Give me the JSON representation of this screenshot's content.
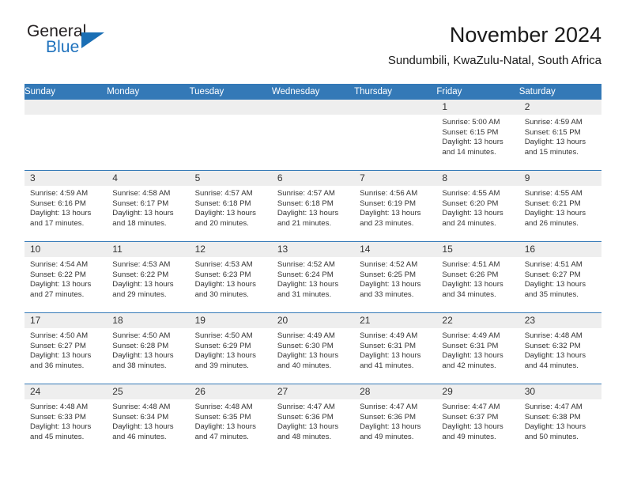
{
  "brand": {
    "name_part1": "General",
    "name_part2": "Blue",
    "triangle_color": "#1a6fb5"
  },
  "header": {
    "title": "November 2024",
    "subtitle": "Sundumbili, KwaZulu-Natal, South Africa"
  },
  "theme": {
    "header_bg": "#3479b7",
    "header_text": "#ffffff",
    "daynum_band_bg": "#eeeeee",
    "row_divider": "#3479b7",
    "body_text": "#333333"
  },
  "calendar": {
    "weekday_headers": [
      "Sunday",
      "Monday",
      "Tuesday",
      "Wednesday",
      "Thursday",
      "Friday",
      "Saturday"
    ],
    "weeks": [
      [
        {
          "day": "",
          "sunrise": "",
          "sunset": "",
          "daylight_line1": "",
          "daylight_line2": ""
        },
        {
          "day": "",
          "sunrise": "",
          "sunset": "",
          "daylight_line1": "",
          "daylight_line2": ""
        },
        {
          "day": "",
          "sunrise": "",
          "sunset": "",
          "daylight_line1": "",
          "daylight_line2": ""
        },
        {
          "day": "",
          "sunrise": "",
          "sunset": "",
          "daylight_line1": "",
          "daylight_line2": ""
        },
        {
          "day": "",
          "sunrise": "",
          "sunset": "",
          "daylight_line1": "",
          "daylight_line2": ""
        },
        {
          "day": "1",
          "sunrise": "Sunrise: 5:00 AM",
          "sunset": "Sunset: 6:15 PM",
          "daylight_line1": "Daylight: 13 hours",
          "daylight_line2": "and 14 minutes."
        },
        {
          "day": "2",
          "sunrise": "Sunrise: 4:59 AM",
          "sunset": "Sunset: 6:15 PM",
          "daylight_line1": "Daylight: 13 hours",
          "daylight_line2": "and 15 minutes."
        }
      ],
      [
        {
          "day": "3",
          "sunrise": "Sunrise: 4:59 AM",
          "sunset": "Sunset: 6:16 PM",
          "daylight_line1": "Daylight: 13 hours",
          "daylight_line2": "and 17 minutes."
        },
        {
          "day": "4",
          "sunrise": "Sunrise: 4:58 AM",
          "sunset": "Sunset: 6:17 PM",
          "daylight_line1": "Daylight: 13 hours",
          "daylight_line2": "and 18 minutes."
        },
        {
          "day": "5",
          "sunrise": "Sunrise: 4:57 AM",
          "sunset": "Sunset: 6:18 PM",
          "daylight_line1": "Daylight: 13 hours",
          "daylight_line2": "and 20 minutes."
        },
        {
          "day": "6",
          "sunrise": "Sunrise: 4:57 AM",
          "sunset": "Sunset: 6:18 PM",
          "daylight_line1": "Daylight: 13 hours",
          "daylight_line2": "and 21 minutes."
        },
        {
          "day": "7",
          "sunrise": "Sunrise: 4:56 AM",
          "sunset": "Sunset: 6:19 PM",
          "daylight_line1": "Daylight: 13 hours",
          "daylight_line2": "and 23 minutes."
        },
        {
          "day": "8",
          "sunrise": "Sunrise: 4:55 AM",
          "sunset": "Sunset: 6:20 PM",
          "daylight_line1": "Daylight: 13 hours",
          "daylight_line2": "and 24 minutes."
        },
        {
          "day": "9",
          "sunrise": "Sunrise: 4:55 AM",
          "sunset": "Sunset: 6:21 PM",
          "daylight_line1": "Daylight: 13 hours",
          "daylight_line2": "and 26 minutes."
        }
      ],
      [
        {
          "day": "10",
          "sunrise": "Sunrise: 4:54 AM",
          "sunset": "Sunset: 6:22 PM",
          "daylight_line1": "Daylight: 13 hours",
          "daylight_line2": "and 27 minutes."
        },
        {
          "day": "11",
          "sunrise": "Sunrise: 4:53 AM",
          "sunset": "Sunset: 6:22 PM",
          "daylight_line1": "Daylight: 13 hours",
          "daylight_line2": "and 29 minutes."
        },
        {
          "day": "12",
          "sunrise": "Sunrise: 4:53 AM",
          "sunset": "Sunset: 6:23 PM",
          "daylight_line1": "Daylight: 13 hours",
          "daylight_line2": "and 30 minutes."
        },
        {
          "day": "13",
          "sunrise": "Sunrise: 4:52 AM",
          "sunset": "Sunset: 6:24 PM",
          "daylight_line1": "Daylight: 13 hours",
          "daylight_line2": "and 31 minutes."
        },
        {
          "day": "14",
          "sunrise": "Sunrise: 4:52 AM",
          "sunset": "Sunset: 6:25 PM",
          "daylight_line1": "Daylight: 13 hours",
          "daylight_line2": "and 33 minutes."
        },
        {
          "day": "15",
          "sunrise": "Sunrise: 4:51 AM",
          "sunset": "Sunset: 6:26 PM",
          "daylight_line1": "Daylight: 13 hours",
          "daylight_line2": "and 34 minutes."
        },
        {
          "day": "16",
          "sunrise": "Sunrise: 4:51 AM",
          "sunset": "Sunset: 6:27 PM",
          "daylight_line1": "Daylight: 13 hours",
          "daylight_line2": "and 35 minutes."
        }
      ],
      [
        {
          "day": "17",
          "sunrise": "Sunrise: 4:50 AM",
          "sunset": "Sunset: 6:27 PM",
          "daylight_line1": "Daylight: 13 hours",
          "daylight_line2": "and 36 minutes."
        },
        {
          "day": "18",
          "sunrise": "Sunrise: 4:50 AM",
          "sunset": "Sunset: 6:28 PM",
          "daylight_line1": "Daylight: 13 hours",
          "daylight_line2": "and 38 minutes."
        },
        {
          "day": "19",
          "sunrise": "Sunrise: 4:50 AM",
          "sunset": "Sunset: 6:29 PM",
          "daylight_line1": "Daylight: 13 hours",
          "daylight_line2": "and 39 minutes."
        },
        {
          "day": "20",
          "sunrise": "Sunrise: 4:49 AM",
          "sunset": "Sunset: 6:30 PM",
          "daylight_line1": "Daylight: 13 hours",
          "daylight_line2": "and 40 minutes."
        },
        {
          "day": "21",
          "sunrise": "Sunrise: 4:49 AM",
          "sunset": "Sunset: 6:31 PM",
          "daylight_line1": "Daylight: 13 hours",
          "daylight_line2": "and 41 minutes."
        },
        {
          "day": "22",
          "sunrise": "Sunrise: 4:49 AM",
          "sunset": "Sunset: 6:31 PM",
          "daylight_line1": "Daylight: 13 hours",
          "daylight_line2": "and 42 minutes."
        },
        {
          "day": "23",
          "sunrise": "Sunrise: 4:48 AM",
          "sunset": "Sunset: 6:32 PM",
          "daylight_line1": "Daylight: 13 hours",
          "daylight_line2": "and 44 minutes."
        }
      ],
      [
        {
          "day": "24",
          "sunrise": "Sunrise: 4:48 AM",
          "sunset": "Sunset: 6:33 PM",
          "daylight_line1": "Daylight: 13 hours",
          "daylight_line2": "and 45 minutes."
        },
        {
          "day": "25",
          "sunrise": "Sunrise: 4:48 AM",
          "sunset": "Sunset: 6:34 PM",
          "daylight_line1": "Daylight: 13 hours",
          "daylight_line2": "and 46 minutes."
        },
        {
          "day": "26",
          "sunrise": "Sunrise: 4:48 AM",
          "sunset": "Sunset: 6:35 PM",
          "daylight_line1": "Daylight: 13 hours",
          "daylight_line2": "and 47 minutes."
        },
        {
          "day": "27",
          "sunrise": "Sunrise: 4:47 AM",
          "sunset": "Sunset: 6:36 PM",
          "daylight_line1": "Daylight: 13 hours",
          "daylight_line2": "and 48 minutes."
        },
        {
          "day": "28",
          "sunrise": "Sunrise: 4:47 AM",
          "sunset": "Sunset: 6:36 PM",
          "daylight_line1": "Daylight: 13 hours",
          "daylight_line2": "and 49 minutes."
        },
        {
          "day": "29",
          "sunrise": "Sunrise: 4:47 AM",
          "sunset": "Sunset: 6:37 PM",
          "daylight_line1": "Daylight: 13 hours",
          "daylight_line2": "and 49 minutes."
        },
        {
          "day": "30",
          "sunrise": "Sunrise: 4:47 AM",
          "sunset": "Sunset: 6:38 PM",
          "daylight_line1": "Daylight: 13 hours",
          "daylight_line2": "and 50 minutes."
        }
      ]
    ]
  }
}
